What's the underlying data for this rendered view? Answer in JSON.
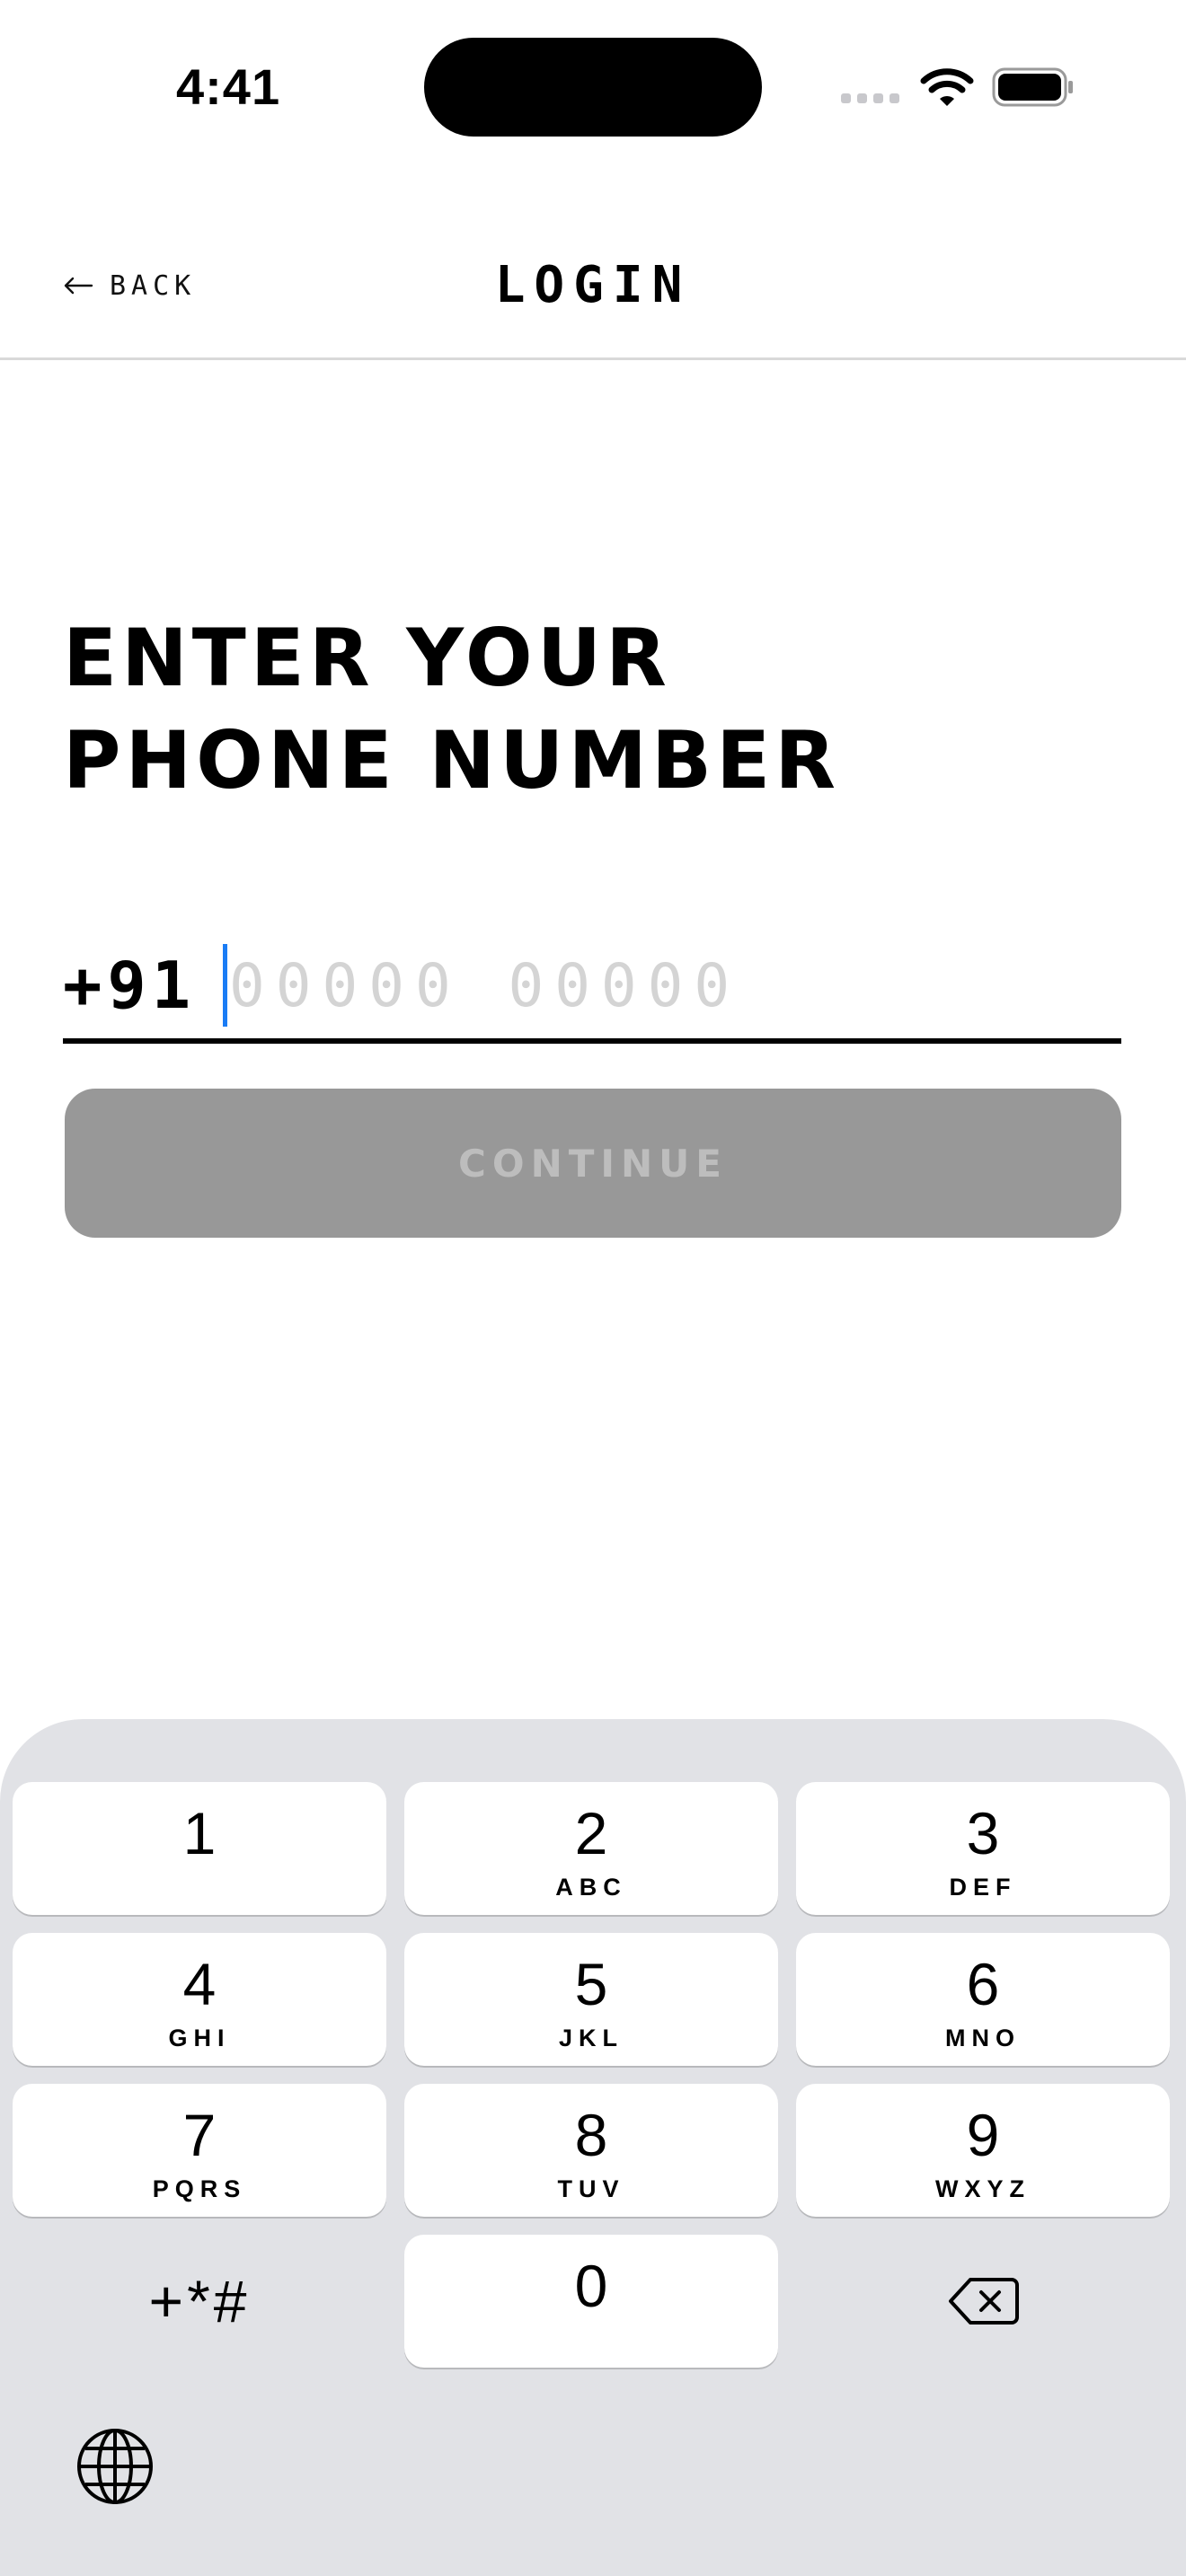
{
  "status_bar": {
    "time": "4:41",
    "icons": [
      "cellular-signal-icon",
      "wifi-icon",
      "battery-icon"
    ]
  },
  "header": {
    "back_label": "BACK",
    "back_icon": "arrow-left-icon",
    "title": "LOGIN"
  },
  "main": {
    "heading_line1": "ENTER YOUR",
    "heading_line2": "PHONE NUMBER",
    "phone": {
      "country_code": "+91",
      "value": "",
      "placeholder": "00000 00000"
    },
    "continue_label": "CONTINUE",
    "continue_enabled": false
  },
  "keypad": {
    "keys": [
      {
        "digit": "1",
        "letters": ""
      },
      {
        "digit": "2",
        "letters": "ABC"
      },
      {
        "digit": "3",
        "letters": "DEF"
      },
      {
        "digit": "4",
        "letters": "GHI"
      },
      {
        "digit": "5",
        "letters": "JKL"
      },
      {
        "digit": "6",
        "letters": "MNO"
      },
      {
        "digit": "7",
        "letters": "PQRS"
      },
      {
        "digit": "8",
        "letters": "TUV"
      },
      {
        "digit": "9",
        "letters": "WXYZ"
      },
      {
        "digit": "0",
        "letters": ""
      }
    ],
    "symbols_label": "+*#",
    "delete_icon": "delete-backspace-icon",
    "globe_icon": "globe-icon"
  },
  "colors": {
    "caret": "#1a7cf5",
    "button_disabled_bg": "#989898",
    "button_disabled_text": "#bdbdbd",
    "keypad_bg": "#e1e2e6",
    "placeholder": "#d4d4d4"
  }
}
